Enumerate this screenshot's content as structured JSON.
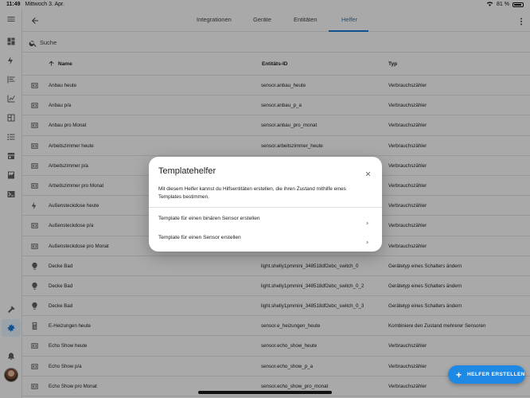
{
  "statusbar": {
    "time": "11:49",
    "date": "Mittwoch 3. Apr.",
    "battery": "81 %"
  },
  "tabs": [
    {
      "label": "Integrationen"
    },
    {
      "label": "Geräte"
    },
    {
      "label": "Entitäten"
    },
    {
      "label": "Helfer",
      "active": true
    }
  ],
  "search": {
    "placeholder": "Suche"
  },
  "table": {
    "headers": {
      "name": "Name",
      "entity": "Entitäts-ID",
      "type": "Typ"
    },
    "rows": [
      {
        "icon": "counter-icon",
        "name": "Anbau heute",
        "entity": "sensor.anbau_heute",
        "type": "Verbrauchszähler"
      },
      {
        "icon": "counter-icon",
        "name": "Anbau p/a",
        "entity": "sensor.anbau_p_a",
        "type": "Verbrauchszähler"
      },
      {
        "icon": "counter-icon",
        "name": "Anbau pro Monat",
        "entity": "sensor.anbau_pro_monat",
        "type": "Verbrauchszähler"
      },
      {
        "icon": "counter-icon",
        "name": "Arbeitszimmer heute",
        "entity": "sensor.arbeitszimmer_heute",
        "type": "Verbrauchszähler"
      },
      {
        "icon": "counter-icon",
        "name": "Arbeitszimmer p/a",
        "entity": "",
        "type": "Verbrauchszähler"
      },
      {
        "icon": "counter-icon",
        "name": "Arbeitszimmer pro Monat",
        "entity": "",
        "type": "Verbrauchszähler"
      },
      {
        "icon": "flash-icon",
        "name": "Außensteckdose heute",
        "entity": "",
        "type": "Verbrauchszähler"
      },
      {
        "icon": "counter-icon",
        "name": "Außensteckdose p/a",
        "entity": "",
        "type": "Verbrauchszähler"
      },
      {
        "icon": "counter-icon",
        "name": "Außensteckdose pro Monat",
        "entity": "",
        "type": "Verbrauchszähler"
      },
      {
        "icon": "lightbulb-icon",
        "name": "Decke Bad",
        "entity": "light.shelly1pmmini_348518df2ebc_switch_0",
        "type": "Gerätetyp eines Schalters ändern"
      },
      {
        "icon": "lightbulb-icon",
        "name": "Decke Bad",
        "entity": "light.shelly1pmmini_348518df2ebc_switch_0_2",
        "type": "Gerätetyp eines Schalters ändern"
      },
      {
        "icon": "lightbulb-icon",
        "name": "Decke Bad",
        "entity": "light.shelly1pmmini_348518df2ebc_switch_0_3",
        "type": "Gerätetyp eines Schalters ändern"
      },
      {
        "icon": "calculator-icon",
        "name": "E-Heizungen heute",
        "entity": "sensor.e_heizungen_heute",
        "type": "Kombiniere den Zustand mehrerer Sensoren"
      },
      {
        "icon": "counter-icon",
        "name": "Echo Show heute",
        "entity": "sensor.echo_show_heute",
        "type": "Verbrauchszähler"
      },
      {
        "icon": "counter-icon",
        "name": "Echo Show p/a",
        "entity": "sensor.echo_show_p_a",
        "type": "Verbrauchszähler"
      },
      {
        "icon": "counter-icon",
        "name": "Echo Show pro Monat",
        "entity": "sensor.echo_show_pro_monat",
        "type": "Verbrauchszähler"
      }
    ]
  },
  "dialog": {
    "title": "Templatehelfer",
    "description": "Mit diesem Helfer kannst du Hilfsentitäten erstellen, die ihren Zustand mithilfe eines Templates bestimmen.",
    "options": [
      {
        "label": "Template für einen binären Sensor erstellen"
      },
      {
        "label": "Template für einen Sensor erstellen"
      }
    ]
  },
  "fab": {
    "label": "HELFER ERSTELLEN"
  }
}
